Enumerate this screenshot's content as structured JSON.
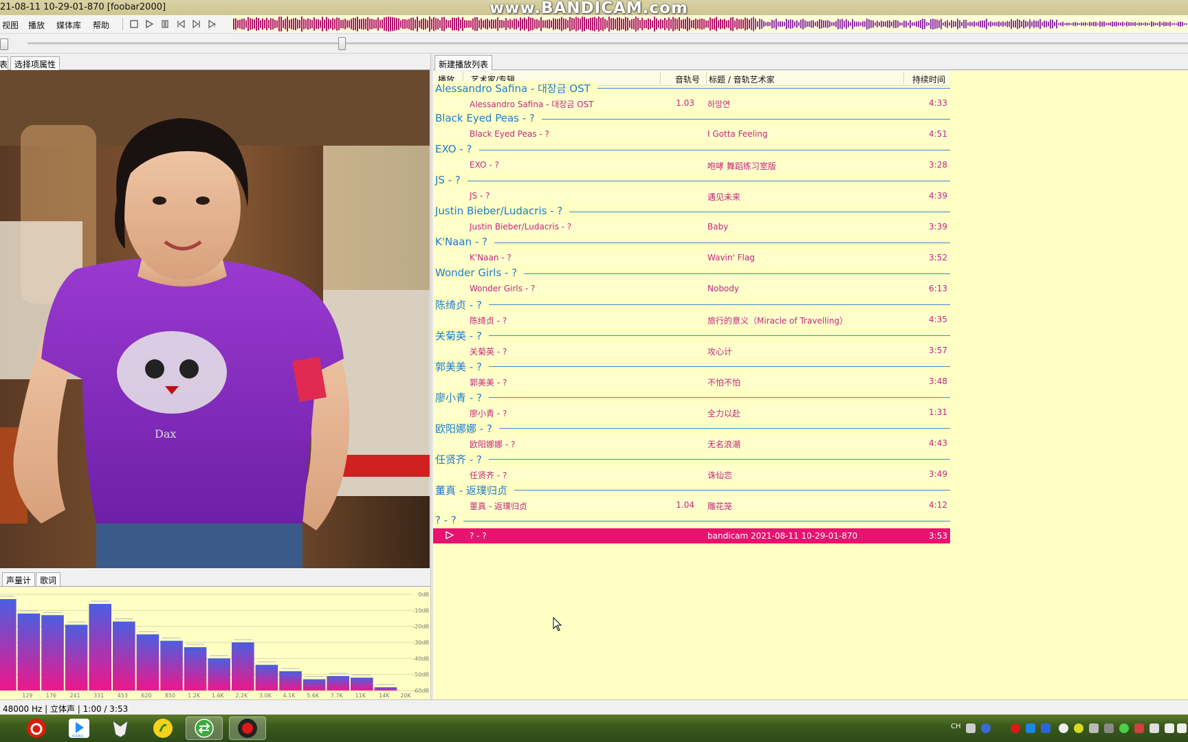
{
  "window": {
    "title": "21-08-11 10-29-01-870  [foobar2000]",
    "watermark": "www.BANDICAM.com"
  },
  "menu": [
    "视图",
    "播放",
    "媒体库",
    "帮助"
  ],
  "toolbar": {
    "icons": [
      "stop-icon",
      "play-icon",
      "pause-icon",
      "previous-icon",
      "next-icon",
      "random-icon"
    ]
  },
  "left_panel": {
    "top_tabs": [
      "表",
      "选择项属性"
    ],
    "bottom_tabs": [
      "声量计",
      "歌词"
    ]
  },
  "spectrum": {
    "db_labels": [
      "0dB",
      "-10dB",
      "-20dB",
      "-30dB",
      "-40dB",
      "-50dB",
      "-60dB"
    ],
    "freq_labels": [
      "129",
      "176",
      "241",
      "331",
      "453",
      "620",
      "850",
      "1.2K",
      "1.6K",
      "2.2K",
      "3.0K",
      "4.1K",
      "5.6K",
      "7.7K",
      "11K",
      "14K",
      "20K"
    ],
    "bar_levels_db": [
      -3,
      -12,
      -13,
      -19,
      -6,
      -17,
      -25,
      -29,
      -33,
      -40,
      -30,
      -44,
      -48,
      -53,
      -51,
      -52,
      -58
    ],
    "colors": {
      "top": "#4a5fe0",
      "bottom": "#f0168a"
    }
  },
  "playlist": {
    "tab": "新建播放列表",
    "columns": [
      "播放...",
      "艺术家/专辑",
      "音轨号",
      "标题 / 音轨艺术家",
      "持续时间"
    ],
    "groups": [
      {
        "header": "Alessandro Safina - 대장금 OST",
        "track": {
          "artist_album": "Alessandro Safina - 대장금 OST",
          "number": "1.03",
          "title": "하망연",
          "duration": "4:33"
        }
      },
      {
        "header": "Black Eyed Peas - ?",
        "track": {
          "artist_album": "Black Eyed Peas - ?",
          "number": "",
          "title": "I Gotta Feeling",
          "duration": "4:51"
        }
      },
      {
        "header": "EXO - ?",
        "track": {
          "artist_album": "EXO - ?",
          "number": "",
          "title": "咆哮 舞蹈练习室版",
          "duration": "3:28"
        }
      },
      {
        "header": "JS - ?",
        "track": {
          "artist_album": "JS - ?",
          "number": "",
          "title": "遇见未来",
          "duration": "4:39"
        }
      },
      {
        "header": "Justin Bieber/Ludacris - ?",
        "track": {
          "artist_album": "Justin Bieber/Ludacris - ?",
          "number": "",
          "title": "Baby",
          "duration": "3:39"
        }
      },
      {
        "header": "K'Naan - ?",
        "track": {
          "artist_album": "K'Naan - ?",
          "number": "",
          "title": "Wavin' Flag",
          "duration": "3:52"
        }
      },
      {
        "header": "Wonder Girls - ?",
        "track": {
          "artist_album": "Wonder Girls - ?",
          "number": "",
          "title": "Nobody",
          "duration": "6:13"
        }
      },
      {
        "header": "陈绮贞 - ?",
        "track": {
          "artist_album": "陈绮贞 - ?",
          "number": "",
          "title": "旅行的意义（Miracle of Travelling）",
          "duration": "4:35"
        }
      },
      {
        "header": "关菊英 - ?",
        "track": {
          "artist_album": "关菊英 - ?",
          "number": "",
          "title": "攻心计",
          "duration": "3:57"
        }
      },
      {
        "header": "郭美美 - ?",
        "track": {
          "artist_album": "郭美美 - ?",
          "number": "",
          "title": "不怕不怕",
          "duration": "3:48"
        }
      },
      {
        "header": "廖小青 - ?",
        "track": {
          "artist_album": "廖小青 - ?",
          "number": "",
          "title": "全力以赴",
          "duration": "1:31"
        }
      },
      {
        "header": "欧阳娜娜 - ?",
        "track": {
          "artist_album": "欧阳娜娜 - ?",
          "number": "",
          "title": "无名浪潮",
          "duration": "4:43"
        }
      },
      {
        "header": "任贤齐 - ?",
        "track": {
          "artist_album": "任贤齐 - ?",
          "number": "",
          "title": "诛仙恋",
          "duration": "3:49"
        }
      },
      {
        "header": "董真 - 返璞归贞",
        "track": {
          "artist_album": "董真 - 返璞归贞",
          "number": "1.04",
          "title": "雕花笼",
          "duration": "4:12"
        }
      },
      {
        "header": "? - ?",
        "track": {
          "artist_album": "? - ?",
          "number": "",
          "title": "bandicam 2021-08-11 10-29-01-870",
          "duration": "3:53",
          "playing": true
        }
      }
    ]
  },
  "status": "48000 Hz | 立体声 | 1:00 / 3:53",
  "taskbar": {
    "apps": [
      "netease-music-icon",
      "youku-icon",
      "media-player-icon",
      "qq-music-icon",
      "sync-icon",
      "bandicam-record-icon"
    ],
    "tray_text": "CH"
  }
}
